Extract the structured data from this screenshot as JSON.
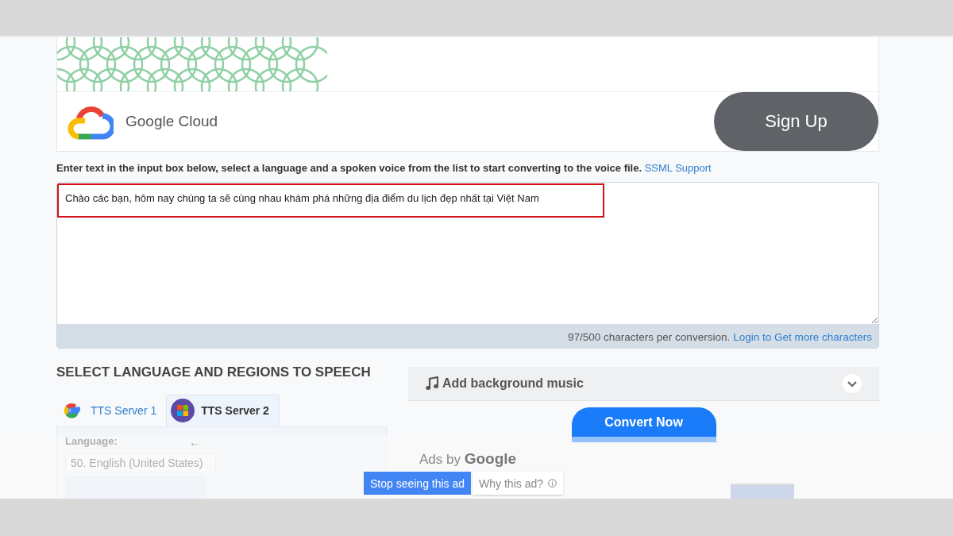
{
  "ad_banner": {
    "brand": "Google Cloud",
    "button": "Sign Up"
  },
  "instructions": {
    "text": "Enter text in the input box below, select a language and a spoken voice from the list to start converting to the voice file.",
    "link": "SSML Support"
  },
  "text_input": {
    "value": "Chào các bạn, hôm nay chúng ta sẽ cùng nhau khám phá những địa điểm du lịch đẹp nhất tại Việt Nam",
    "highlighted": true
  },
  "counter": {
    "text": "97/500 characters per conversion.",
    "link": "Login to Get more characters"
  },
  "language_section": {
    "heading": "SELECT LANGUAGE AND REGIONS TO SPEECH",
    "tabs": [
      {
        "label": "TTS Server 1",
        "kind": "google",
        "selected": false
      },
      {
        "label": "TTS Server 2",
        "kind": "windows",
        "selected": true
      }
    ],
    "language_label": "Language:",
    "back_arrow": "←",
    "language_value": "50. English (United States)"
  },
  "music": {
    "label": "Add background music",
    "expanded": false
  },
  "convert_button": "Convert Now",
  "ad_overlay": {
    "attribution": "Ads by",
    "brand": "Google",
    "buttons": [
      {
        "label": "Stop seeing this ad",
        "kind": "primary"
      },
      {
        "label": "Why this ad?",
        "kind": "secondary"
      }
    ]
  }
}
